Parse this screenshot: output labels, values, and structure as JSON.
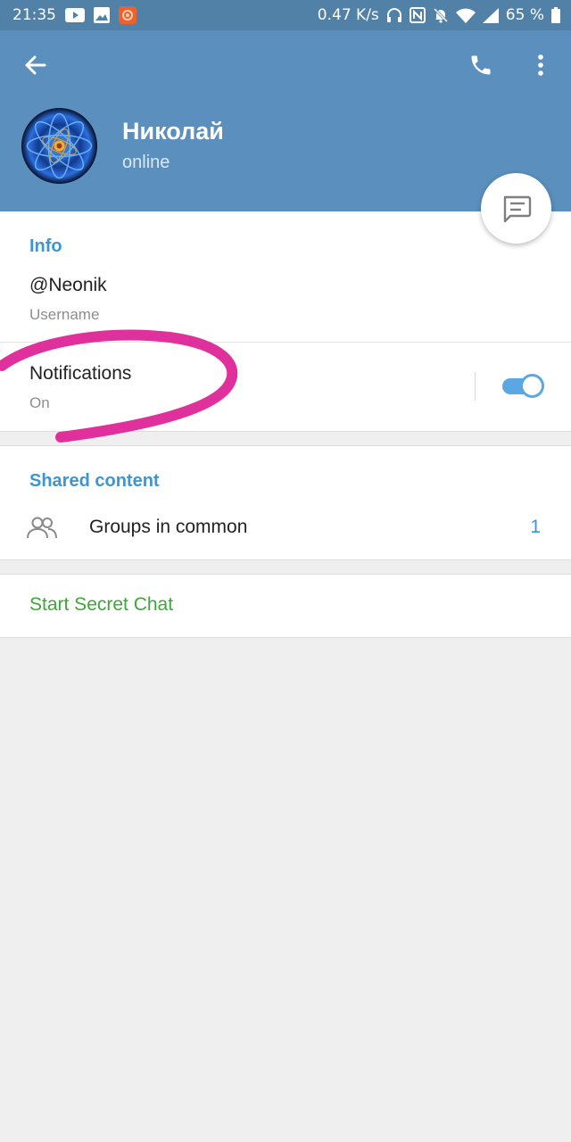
{
  "status_bar": {
    "time": "21:35",
    "network_speed": "0.47 K/s",
    "battery": "65 %",
    "icons": [
      "youtube-icon",
      "gallery-icon",
      "app-icon",
      "headphones-icon",
      "nfc-icon",
      "mute-icon",
      "wifi-icon",
      "signal-icon",
      "battery-icon"
    ]
  },
  "header": {
    "back_icon": "arrow-back-icon",
    "call_icon": "phone-icon",
    "more_icon": "more-vert-icon",
    "name": "Николай",
    "status": "online",
    "fab_icon": "message-icon"
  },
  "info": {
    "title": "Info",
    "username": "@Neonik",
    "username_label": "Username",
    "notifications_label": "Notifications",
    "notifications_value": "On",
    "notifications_enabled": true
  },
  "shared": {
    "title": "Shared content",
    "groups_label": "Groups in common",
    "groups_count": "1",
    "groups_icon": "group-icon"
  },
  "secret_chat": {
    "label": "Start Secret Chat"
  },
  "colors": {
    "header": "#5b8fbd",
    "status_bar": "#5281a8",
    "accent_blue": "#3e95cf",
    "secret_green": "#3ea63a",
    "annotation": "#e0309b",
    "background": "#efefef"
  }
}
